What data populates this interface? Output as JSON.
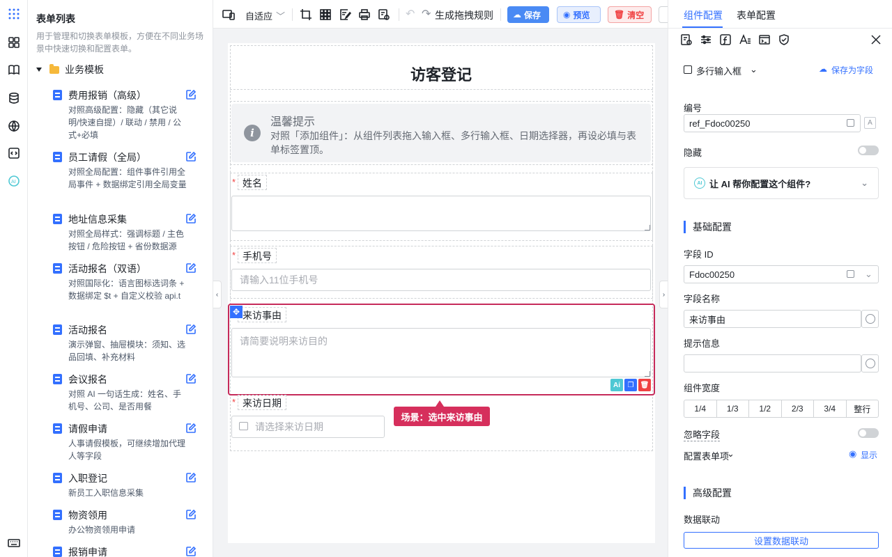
{
  "left_panel": {
    "title": "表单列表",
    "description": "用于管理和切换表单模板，方便在不同业务场景中快速切换和配置表单。",
    "group": "业务模板",
    "items": [
      {
        "name": "费用报销（高级）",
        "desc": "对照高级配置：隐藏（其它说明/快速自提）/ 联动 / 禁用 / 公式+必填"
      },
      {
        "name": "员工请假（全局）",
        "desc": "对照全局配置：组件事件引用全局事件 + 数据绑定引用全局变量"
      },
      {
        "name": "地址信息采集",
        "desc": "对照全局样式：强调标题 / 主色按钮 / 危险按钮 + 省份数据源"
      },
      {
        "name": "活动报名（双语）",
        "desc": "对照国际化：语言图标选词条 + 数据绑定 $t + 自定义校验 api.t"
      },
      {
        "name": "活动报名",
        "desc": "演示弹窗、抽屉模块：须知、选品回填、补充材料"
      },
      {
        "name": "会议报名",
        "desc": "对照 AI 一句话生成：姓名、手机号、公司、是否用餐"
      },
      {
        "name": "请假申请",
        "desc": "人事请假模板，可继续增加代理人等字段"
      },
      {
        "name": "入职登记",
        "desc": "新员工入职信息采集"
      },
      {
        "name": "物资领用",
        "desc": "办公物资领用申请"
      },
      {
        "name": "报销申请",
        "desc": ""
      }
    ]
  },
  "toolbar": {
    "zoom": "自适应",
    "generate_rules": "生成拖拽规则",
    "save": "保存",
    "preview": "预览",
    "clear": "清空"
  },
  "form": {
    "title": "访客登记",
    "tip_title": "温馨提示",
    "tip_text": "对照「添加组件」：从组件列表拖入输入框、多行输入框、日期选择器，再设必填与表单标签置顶。",
    "fields": [
      {
        "label": "姓名",
        "placeholder": ""
      },
      {
        "label": "手机号",
        "placeholder": "请输入11位手机号"
      },
      {
        "label": "来访事由",
        "placeholder": "请简要说明来访目的"
      },
      {
        "label": "来访日期",
        "placeholder": "请选择来访日期"
      }
    ],
    "callout": "场景：选中来访事由"
  },
  "right_panel": {
    "tab_component": "组件配置",
    "tab_form": "表单配置",
    "component_type": "多行输入框",
    "save_as_field": "保存为字段",
    "id_label": "编号",
    "id_value": "ref_Fdoc00250",
    "hidden_label": "隐藏",
    "ai_prompt": "让 AI 帮你配置这个组件?",
    "basic_section": "基础配置",
    "field_id_label": "字段 ID",
    "field_id_value": "Fdoc00250",
    "field_name_label": "字段名称",
    "field_name_value": "来访事由",
    "hint_label": "提示信息",
    "hint_value": "",
    "width_label": "组件宽度",
    "width_options": [
      "1/4",
      "1/3",
      "1/2",
      "2/3",
      "3/4",
      "整行"
    ],
    "ignore_label": "忽略字段",
    "config_items": "配置表单项",
    "show": "显示",
    "advanced_section": "高级配置",
    "linkage_label": "数据联动",
    "linkage_button": "设置数据联动"
  }
}
